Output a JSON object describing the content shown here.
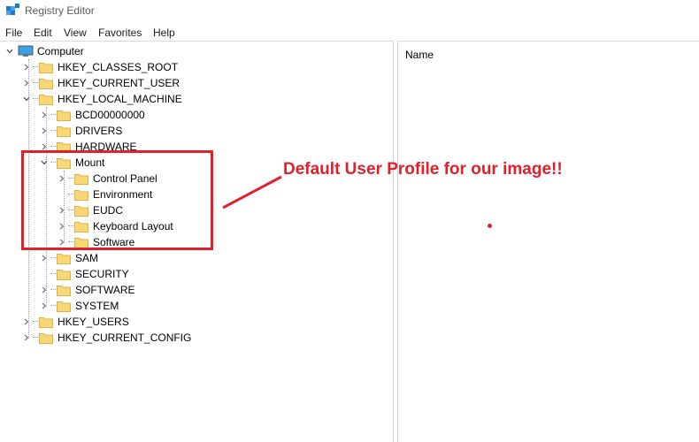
{
  "window": {
    "title": "Registry Editor"
  },
  "menu": [
    "File",
    "Edit",
    "View",
    "Favorites",
    "Help"
  ],
  "values_pane": {
    "column_name": "Name"
  },
  "tree": {
    "root": "Computer",
    "hives": {
      "classes_root": "HKEY_CLASSES_ROOT",
      "current_user": "HKEY_CURRENT_USER",
      "local_machine": "HKEY_LOCAL_MACHINE",
      "users": "HKEY_USERS",
      "current_config": "HKEY_CURRENT_CONFIG"
    },
    "hklm_children": {
      "bcd": "BCD00000000",
      "drivers": "DRIVERS",
      "hardware": "HARDWARE",
      "mount": "Mount",
      "sam": "SAM",
      "security": "SECURITY",
      "software": "SOFTWARE",
      "system": "SYSTEM"
    },
    "mount_children": {
      "control_panel": "Control Panel",
      "environment": "Environment",
      "eudc": "EUDC",
      "keyboard_layout": "Keyboard Layout",
      "software": "Software"
    }
  },
  "annotation": {
    "text": "Default User Profile for our image!!",
    "color": "#e0202a"
  }
}
